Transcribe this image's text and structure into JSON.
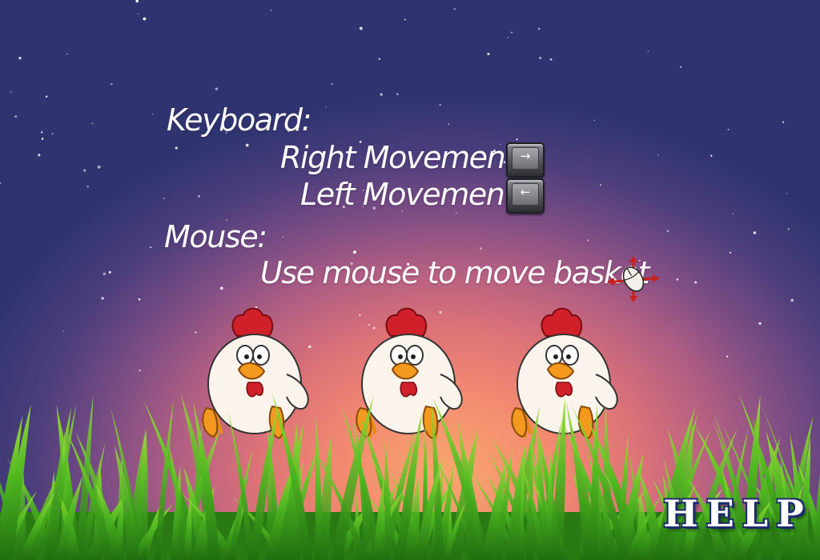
{
  "help_screen": {
    "keyboard_heading": "Keyboard:",
    "right_movement_label": "Right Movement:",
    "left_movement_label": "Left Movement:",
    "right_key_glyph": "→",
    "left_key_glyph": "←",
    "mouse_heading": "Mouse:",
    "mouse_instruction": "Use mouse to move basket",
    "help_button_label": "HELP"
  },
  "icons": {
    "right_key": "right-arrow-key-icon",
    "left_key": "left-arrow-key-icon",
    "mouse": "mouse-move-icon"
  },
  "colors": {
    "sky_top": "#2f3470",
    "sky_glow": "#f8a66e",
    "grass": "#4fb820",
    "comb": "#d0202a",
    "help_outline": "#1c2a6e"
  }
}
